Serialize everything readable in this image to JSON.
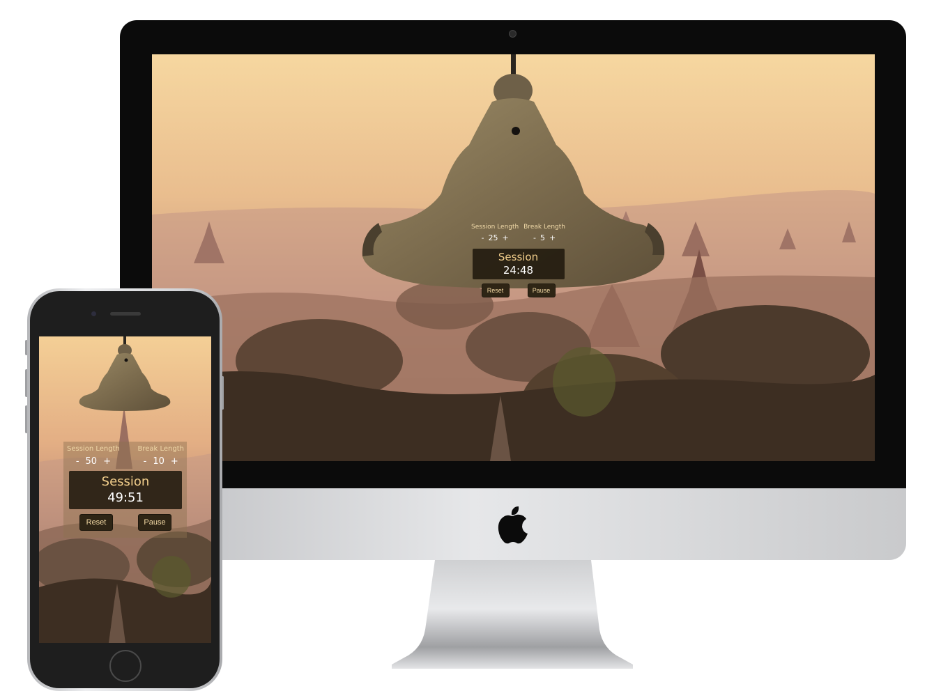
{
  "desktop": {
    "session_length_label": "Session Length",
    "break_length_label": "Break Length",
    "session_length": "25",
    "break_length": "5",
    "decrement": "-",
    "increment": "+",
    "mode": "Session",
    "time": "24:48",
    "reset_label": "Reset",
    "pause_label": "Pause"
  },
  "mobile": {
    "session_length_label": "Session Length",
    "break_length_label": "Break Length",
    "session_length": "50",
    "break_length": "10",
    "decrement": "-",
    "increment": "+",
    "mode": "Session",
    "time": "49:51",
    "reset_label": "Reset",
    "pause_label": "Pause"
  },
  "icons": {
    "bell": "bell-icon",
    "apple_logo": "apple-logo-icon"
  },
  "colors": {
    "sky_top": "#f6d7a0",
    "haze": "#b98a74",
    "bell_bronze": "#7c6c4e",
    "display_bg": "#20190e",
    "button_bg": "#2e2515",
    "button_text": "#f6dca6"
  }
}
